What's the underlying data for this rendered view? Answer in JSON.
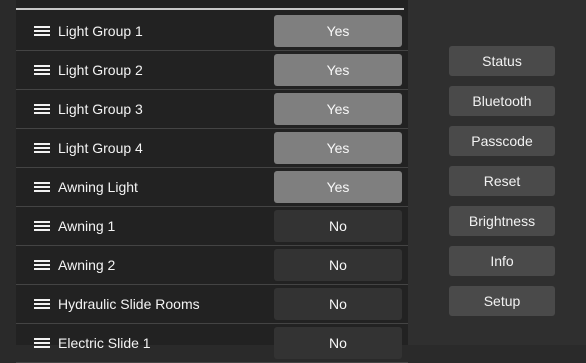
{
  "rows": [
    {
      "label": "Light Group 1",
      "value": "Yes",
      "state": "on"
    },
    {
      "label": "Light Group 2",
      "value": "Yes",
      "state": "on"
    },
    {
      "label": "Light Group 3",
      "value": "Yes",
      "state": "on"
    },
    {
      "label": "Light Group 4",
      "value": "Yes",
      "state": "on"
    },
    {
      "label": "Awning Light",
      "value": "Yes",
      "state": "on"
    },
    {
      "label": "Awning 1",
      "value": "No",
      "state": "off"
    },
    {
      "label": "Awning 2",
      "value": "No",
      "state": "off"
    },
    {
      "label": "Hydraulic Slide Rooms",
      "value": "No",
      "state": "off"
    },
    {
      "label": "Electric Slide 1",
      "value": "No",
      "state": "off"
    }
  ],
  "side_buttons": [
    {
      "label": "Status"
    },
    {
      "label": "Bluetooth"
    },
    {
      "label": "Passcode"
    },
    {
      "label": "Reset"
    },
    {
      "label": "Brightness"
    },
    {
      "label": "Info"
    },
    {
      "label": "Setup"
    }
  ],
  "colors": {
    "on": "#7f7f7f",
    "off": "#333333",
    "button": "#4a4a4a",
    "background": "#2a2a2a"
  }
}
